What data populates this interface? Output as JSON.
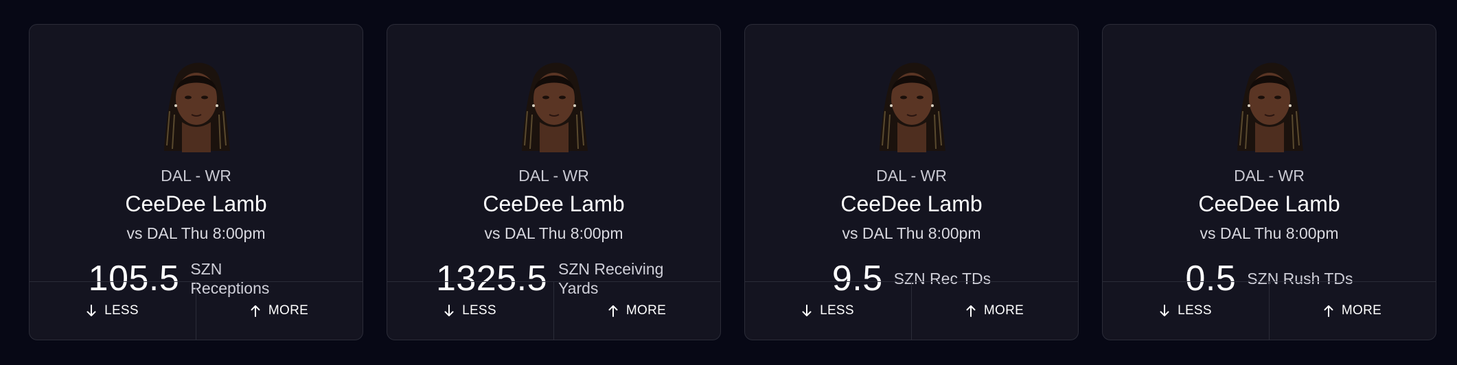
{
  "colors": {
    "page_background": "#070815",
    "card_background": "#141420",
    "card_border": "#2b2c38",
    "text_primary": "#ffffff",
    "text_secondary": "#c9c9d2"
  },
  "cards": [
    {
      "team_pos": "DAL - WR",
      "player_name": "CeeDee Lamb",
      "game_info": "vs DAL Thu 8:00pm",
      "line_value": "105.5",
      "line_label": "SZN Receptions",
      "less_label": "LESS",
      "more_label": "MORE",
      "less_icon": "arrow-down-icon",
      "more_icon": "arrow-up-icon"
    },
    {
      "team_pos": "DAL - WR",
      "player_name": "CeeDee Lamb",
      "game_info": "vs DAL Thu 8:00pm",
      "line_value": "1325.5",
      "line_label": "SZN Receiving Yards",
      "less_label": "LESS",
      "more_label": "MORE",
      "less_icon": "arrow-down-icon",
      "more_icon": "arrow-up-icon"
    },
    {
      "team_pos": "DAL - WR",
      "player_name": "CeeDee Lamb",
      "game_info": "vs DAL Thu 8:00pm",
      "line_value": "9.5",
      "line_label": "SZN Rec TDs",
      "less_label": "LESS",
      "more_label": "MORE",
      "less_icon": "arrow-down-icon",
      "more_icon": "arrow-up-icon"
    },
    {
      "team_pos": "DAL - WR",
      "player_name": "CeeDee Lamb",
      "game_info": "vs DAL Thu 8:00pm",
      "line_value": "0.5",
      "line_label": "SZN Rush TDs",
      "less_label": "LESS",
      "more_label": "MORE",
      "less_icon": "arrow-down-icon",
      "more_icon": "arrow-up-icon"
    }
  ]
}
